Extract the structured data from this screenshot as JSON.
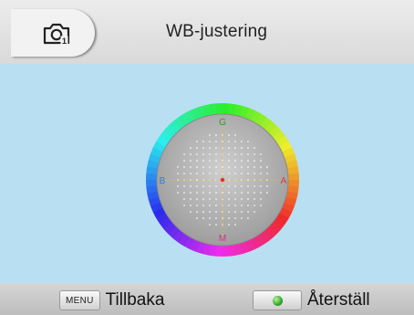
{
  "header": {
    "icon": "camera-icon",
    "title": "WB-justering"
  },
  "wb_grid": {
    "labels": {
      "top": "G",
      "bottom": "M",
      "left": "B",
      "right": "A"
    },
    "colors": {
      "top": "#2a9a3a",
      "bottom": "#d0308a",
      "left": "#2f7fd0",
      "right": "#e03a3a",
      "cursor": "#e03030"
    },
    "cursor": {
      "ga_offset": 0,
      "bm_offset": 0
    }
  },
  "footer": {
    "back_key": "MENU",
    "back_label": "Tillbaka",
    "reset_key_icon": "green-button-icon",
    "reset_label": "Återställ"
  }
}
